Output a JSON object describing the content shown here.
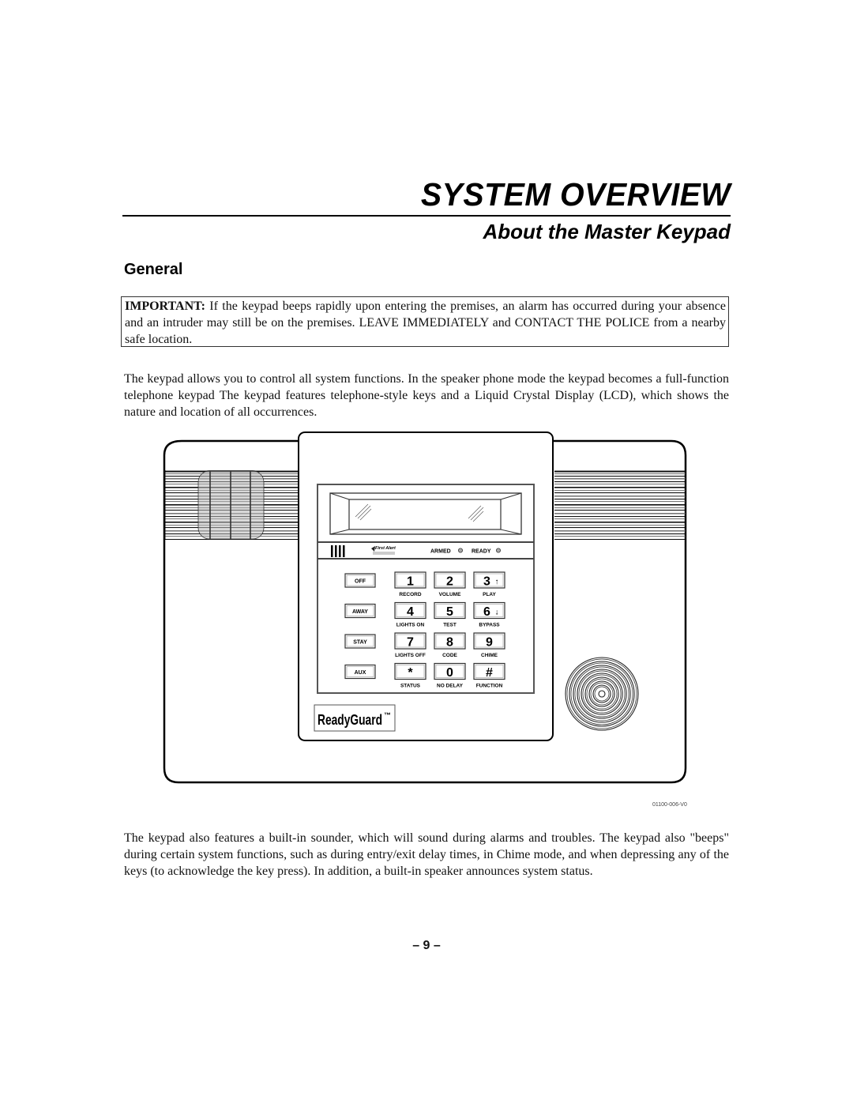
{
  "header": {
    "title": "SYSTEM OVERVIEW",
    "subtitle": "About the Master Keypad"
  },
  "section": {
    "heading": "General"
  },
  "important_box": {
    "lead": "IMPORTANT:",
    "text": " If the keypad beeps rapidly upon entering the premises, an alarm has occurred during your absence and an intruder may still be on the premises. LEAVE IMMEDIATELY and CONTACT THE POLICE from a nearby safe location."
  },
  "paragraphs": [
    "The keypad allows you to control all system functions. In the speaker phone mode the keypad becomes a full-function telephone keypad The keypad features telephone-style keys and a Liquid Crystal Display (LCD), which shows the nature and location of all occurrences.",
    "The keypad also features a built-in sounder, which will sound during alarms and troubles. The keypad also \"beeps\" during certain system functions, such as during entry/exit delay times, in Chime mode, and when depressing any of the keys (to acknowledge the key press). In addition, a built-in speaker announces system status."
  ],
  "figure": {
    "code": "01100-006-V0",
    "brand": "ReadyGuard",
    "brand_mark": "™",
    "logo_text": "First Alert",
    "indicators": [
      {
        "label": "ARMED"
      },
      {
        "label": "READY"
      }
    ],
    "function_keys": [
      {
        "label": "OFF"
      },
      {
        "label": "AWAY"
      },
      {
        "label": "STAY"
      },
      {
        "label": "AUX"
      }
    ],
    "keys": [
      {
        "key": "1",
        "sub": "RECORD",
        "icon": ""
      },
      {
        "key": "2",
        "sub": "VOLUME",
        "icon": ""
      },
      {
        "key": "3",
        "sub": "PLAY",
        "icon": "↑"
      },
      {
        "key": "4",
        "sub": "LIGHTS ON",
        "icon": ""
      },
      {
        "key": "5",
        "sub": "TEST",
        "icon": ""
      },
      {
        "key": "6",
        "sub": "BYPASS",
        "icon": "↓"
      },
      {
        "key": "7",
        "sub": "LIGHTS OFF",
        "icon": ""
      },
      {
        "key": "8",
        "sub": "CODE",
        "icon": ""
      },
      {
        "key": "9",
        "sub": "CHIME",
        "icon": ""
      },
      {
        "key": "*",
        "sub": "STATUS",
        "icon": ""
      },
      {
        "key": "0",
        "sub": "NO DELAY",
        "icon": ""
      },
      {
        "key": "#",
        "sub": "FUNCTION",
        "icon": ""
      }
    ]
  },
  "footer": {
    "page_number": "– 9 –"
  }
}
